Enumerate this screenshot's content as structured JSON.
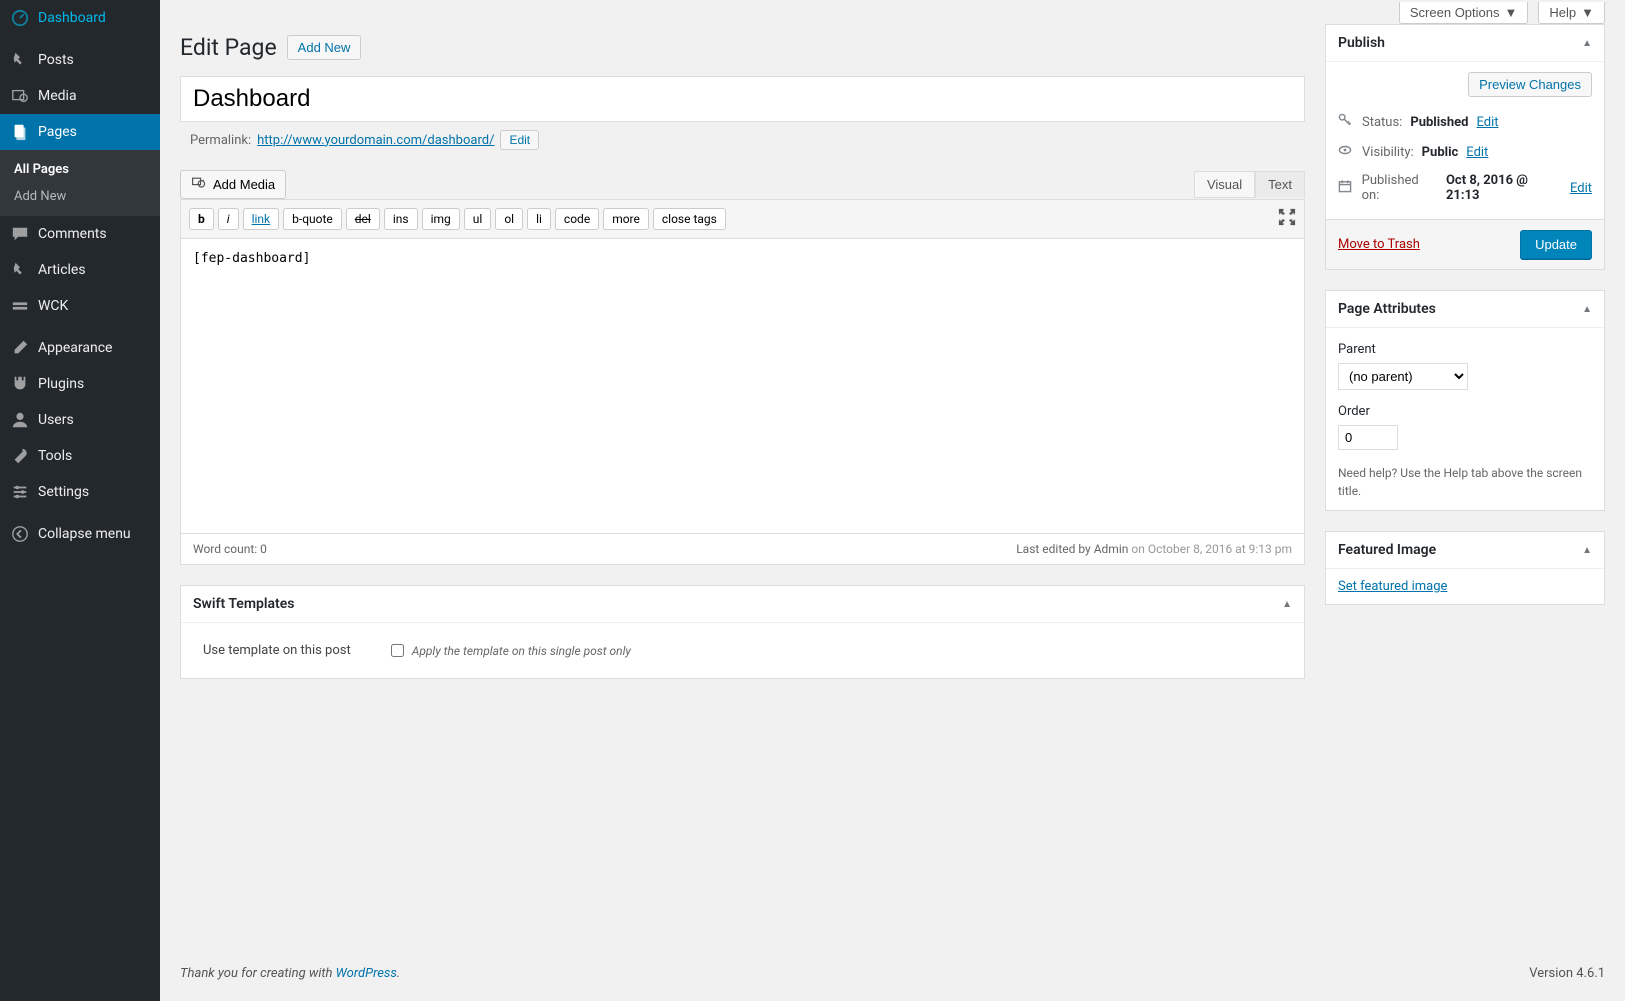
{
  "topbar": {
    "screen_options": "Screen Options",
    "help": "Help"
  },
  "sidebar": {
    "items": [
      {
        "label": "Dashboard",
        "icon": "dashboard"
      },
      {
        "label": "Posts",
        "icon": "pin"
      },
      {
        "label": "Media",
        "icon": "media"
      },
      {
        "label": "Pages",
        "icon": "pages",
        "active": true
      },
      {
        "label": "Comments",
        "icon": "comment"
      },
      {
        "label": "Articles",
        "icon": "pin"
      },
      {
        "label": "WCK",
        "icon": "wck"
      },
      {
        "label": "Appearance",
        "icon": "brush"
      },
      {
        "label": "Plugins",
        "icon": "plugin"
      },
      {
        "label": "Users",
        "icon": "user"
      },
      {
        "label": "Tools",
        "icon": "wrench"
      },
      {
        "label": "Settings",
        "icon": "settings"
      }
    ],
    "sub": {
      "all_pages": "All Pages",
      "add_new": "Add New"
    },
    "collapse": "Collapse menu"
  },
  "heading": {
    "title": "Edit Page",
    "add_new": "Add New"
  },
  "title_field": "Dashboard",
  "permalink": {
    "label": "Permalink:",
    "url": "http://www.yourdomain.com/dashboard/",
    "edit": "Edit"
  },
  "editor": {
    "add_media": "Add Media",
    "tabs": {
      "visual": "Visual",
      "text": "Text"
    },
    "qt": [
      "b",
      "i",
      "link",
      "b-quote",
      "del",
      "ins",
      "img",
      "ul",
      "ol",
      "li",
      "code",
      "more",
      "close tags"
    ],
    "content": "[fep-dashboard]",
    "word_count_label": "Word count: 0",
    "last_edited_prefix": "Last edited by Admin",
    "last_edited_suffix": "on October 8, 2016 at 9:13 pm"
  },
  "swift": {
    "title": "Swift Templates",
    "use_label": "Use template on this post",
    "apply_label": "Apply the template on this single post only"
  },
  "publish": {
    "title": "Publish",
    "preview": "Preview Changes",
    "status_label": "Status:",
    "status_value": "Published",
    "visibility_label": "Visibility:",
    "visibility_value": "Public",
    "published_label": "Published on:",
    "published_value": "Oct 8, 2016 @ 21:13",
    "edit": "Edit",
    "trash": "Move to Trash",
    "update": "Update"
  },
  "attributes": {
    "title": "Page Attributes",
    "parent_label": "Parent",
    "parent_value": "(no parent)",
    "order_label": "Order",
    "order_value": "0",
    "help": "Need help? Use the Help tab above the screen title."
  },
  "featured": {
    "title": "Featured Image",
    "set": "Set featured image"
  },
  "footer": {
    "thank_you": "Thank you for creating with ",
    "wp": "WordPress",
    "dot": ".",
    "version": "Version 4.6.1"
  }
}
